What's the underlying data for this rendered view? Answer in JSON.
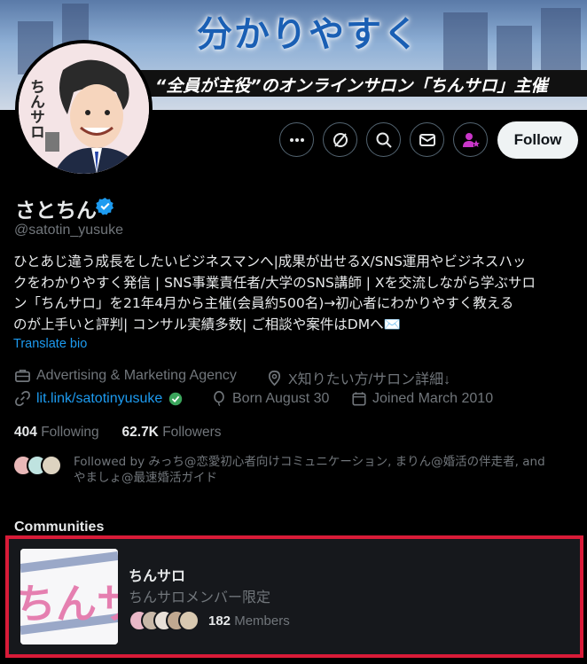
{
  "banner": {
    "title": "分かりやすく",
    "subtitle_em": "“全員が主役”",
    "subtitle_rest": "のオンラインサロン「ちんサロ」主催"
  },
  "avatar": {
    "text": "ちんサロ"
  },
  "actions": {
    "more_icon": "more-horizontal-icon",
    "grok_icon": "grok-icon",
    "search_icon": "search-icon",
    "message_icon": "mail-icon",
    "subscribe_icon": "person-star-icon",
    "follow_label": "Follow"
  },
  "profile": {
    "name": "さとちん",
    "handle": "@satotin_yusuke",
    "bio_lines": [
      "ひとあじ違う成長をしたいビジネスマンへ|成果が出せるX/SNS運用やビジネスハッ",
      "クをわかりやすく発信 | SNS事業責任者/大学のSNS講師 | Xを交流しながら学ぶサロ",
      "ン「ちんサロ」を21年4月から主催(会員約500名)→初心者にわかりやすく教える",
      "のが上手いと評判| コンサル実績多数| ご相談や案件はDMへ✉️"
    ],
    "translate_label": "Translate bio",
    "category": "Advertising & Marketing Agency",
    "location": "X知りたい方/サロン詳細↓",
    "website": "lit.link/satotinyusuke",
    "birthday": "Born August 30",
    "joined": "Joined March 2010"
  },
  "stats": {
    "following_count": "404",
    "following_label": "Following",
    "followers_count": "62.7K",
    "followers_label": "Followers"
  },
  "followed_by": {
    "line1": "Followed by みっち@恋愛初心者向けコミュニケーション, まりん@婚活の伴走者, and",
    "line2": "やましょ@最速婚活ガイド"
  },
  "communities": {
    "title": "Communities",
    "items": [
      {
        "name": "ちんサロ",
        "description": "ちんサロメンバー限定",
        "member_count": "182",
        "member_label": "Members",
        "thumb_text": "ちんサ"
      }
    ]
  },
  "colors": {
    "accent": "#1d9bf0",
    "verified": "#1d9bf0",
    "highlight_border": "#d81b38",
    "subscribe": "#c936c9"
  }
}
